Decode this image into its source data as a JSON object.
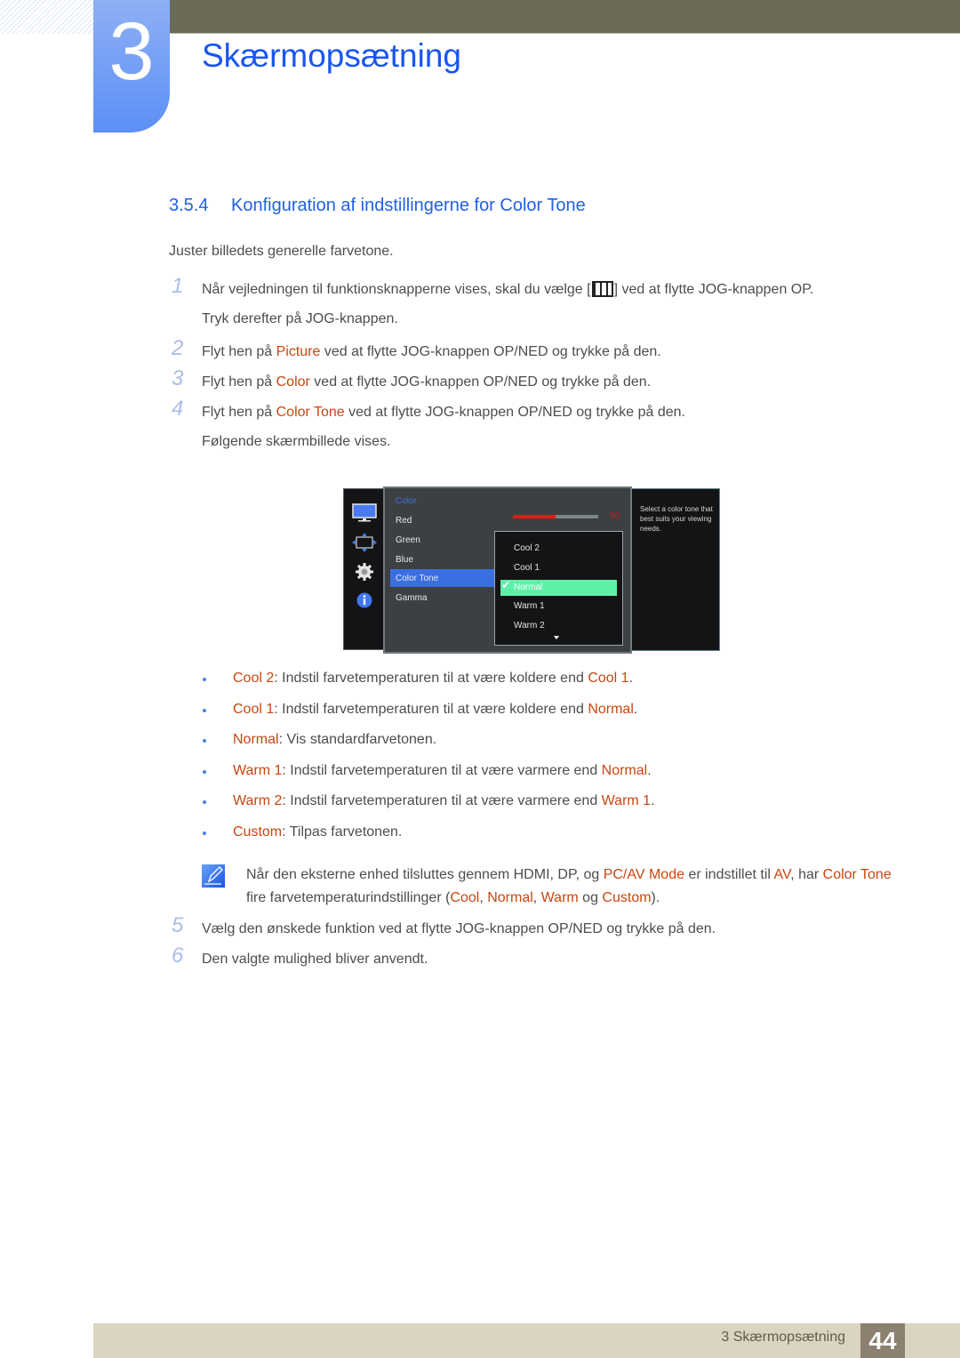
{
  "header": {
    "chapter_number": "3",
    "chapter_title": "Skærmopsætning"
  },
  "section": {
    "number": "3.5.4",
    "title": "Konfiguration af indstillingerne for Color Tone",
    "intro": "Juster billedets generelle farvetone."
  },
  "steps": [
    {
      "n": "1",
      "parts": [
        "Når vejledningen til funktionsknapperne vises, skal du vælge [",
        "] ved at flytte JOG-knappen OP."
      ],
      "line2": "Tryk derefter på JOG-knappen.",
      "icon": "menu-icon"
    },
    {
      "n": "2",
      "pre": "Flyt hen på ",
      "hl": "Picture",
      "post": " ved at flytte JOG-knappen OP/NED og trykke på den."
    },
    {
      "n": "3",
      "pre": "Flyt hen på ",
      "hl": "Color",
      "post": " ved at flytte JOG-knappen OP/NED og trykke på den."
    },
    {
      "n": "4",
      "pre": "Flyt hen på ",
      "hl": "Color Tone",
      "post": " ved at flytte JOG-knappen OP/NED og trykke på den.",
      "line2": "Følgende skærmbillede vises."
    },
    {
      "n": "5",
      "text": "Vælg den ønskede funktion ved at flytte JOG-knappen OP/NED og trykke på den."
    },
    {
      "n": "6",
      "text": "Den valgte mulighed bliver anvendt."
    }
  ],
  "osd": {
    "side_icons": [
      "monitor-icon",
      "resize-icon",
      "gear-icon",
      "info-icon"
    ],
    "heading": "Color",
    "items": [
      "Red",
      "Green",
      "Blue",
      "Color Tone",
      "Gamma"
    ],
    "selected_item": "Color Tone",
    "slider_value": "50",
    "slider_fraction": 0.5,
    "dropdown": [
      "Cool 2",
      "Cool 1",
      "Normal",
      "Warm 1",
      "Warm 2"
    ],
    "dropdown_selected": "Normal",
    "help_text": "Select a color tone that best suits your viewing needs."
  },
  "bullets": [
    {
      "term": "Cool 2",
      "text": ": Indstil farvetemperaturen til at være koldere end ",
      "ref": "Cool 1",
      "end": "."
    },
    {
      "term": "Cool 1",
      "text": ": Indstil farvetemperaturen til at være koldere end ",
      "ref": "Normal",
      "end": "."
    },
    {
      "term": "Normal",
      "text": ": Vis standardfarvetonen.",
      "ref": "",
      "end": ""
    },
    {
      "term": "Warm 1",
      "text": ": Indstil farvetemperaturen til at være varmere end ",
      "ref": "Normal",
      "end": "."
    },
    {
      "term": "Warm 2",
      "text": ": Indstil farvetemperaturen til at være varmere end ",
      "ref": "Warm 1",
      "end": "."
    },
    {
      "term": "Custom",
      "text": ": Tilpas farvetonen.",
      "ref": "",
      "end": ""
    }
  ],
  "note": {
    "icon": "note-pencil-icon",
    "p1": "Når den eksterne enhed tilsluttes gennem HDMI, DP, og ",
    "h1": "PC/AV Mode",
    "p2": " er indstillet til ",
    "h2": "AV",
    "p3": ", har ",
    "h3": "Color Tone",
    "p4": " fire farvetemperaturindstillinger (",
    "h4": "Cool",
    "p5": ", ",
    "h5": "Normal",
    "p6": ", ",
    "h6": "Warm",
    "p7": " og ",
    "h7": "Custom",
    "p8": ")."
  },
  "footer": {
    "title": "3 Skærmopsætning",
    "page": "44"
  },
  "colors": {
    "accent_blue": "#1a55f3",
    "highlight_orange": "#c8460f",
    "topbar": "#6c6b58",
    "footer_bg": "#dad5c0",
    "osd_selected": "#3a6fe2",
    "osd_dropdown_selected": "#5ff0a8"
  }
}
